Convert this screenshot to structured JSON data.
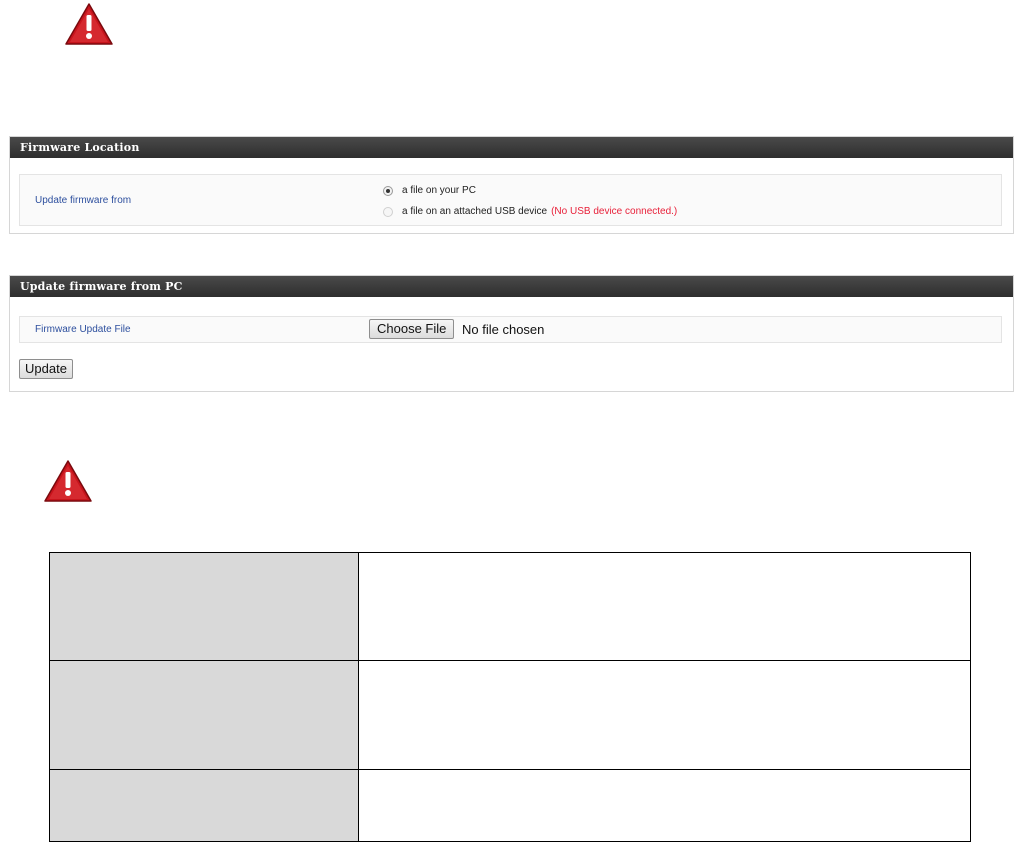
{
  "icons": {
    "top_warning": "warning-icon",
    "bottom_warning": "warning-icon",
    "warning_color": "#c8141c"
  },
  "firmware_location": {
    "title": "Firmware Location",
    "label": "Update firmware from",
    "options": [
      {
        "label": "a file on your PC",
        "selected": true,
        "disabled": false
      },
      {
        "label": "a file on an attached USB device",
        "selected": false,
        "disabled": true
      }
    ],
    "usb_status": "(No USB device connected.)"
  },
  "update_from_pc": {
    "title": "Update firmware from PC",
    "label": "Firmware Update File",
    "choose_file_label": "Choose File",
    "file_status": "No file chosen",
    "update_label": "Update"
  },
  "info_table": {
    "rows": [
      {
        "key": "",
        "value": ""
      },
      {
        "key": "",
        "value": ""
      },
      {
        "key": "",
        "value": ""
      }
    ]
  },
  "colors": {
    "header_bg": "#333333",
    "label_blue": "#2d4f9e",
    "usb_status_red": "#e8213a",
    "table_key_bg": "#d9d9d9"
  }
}
